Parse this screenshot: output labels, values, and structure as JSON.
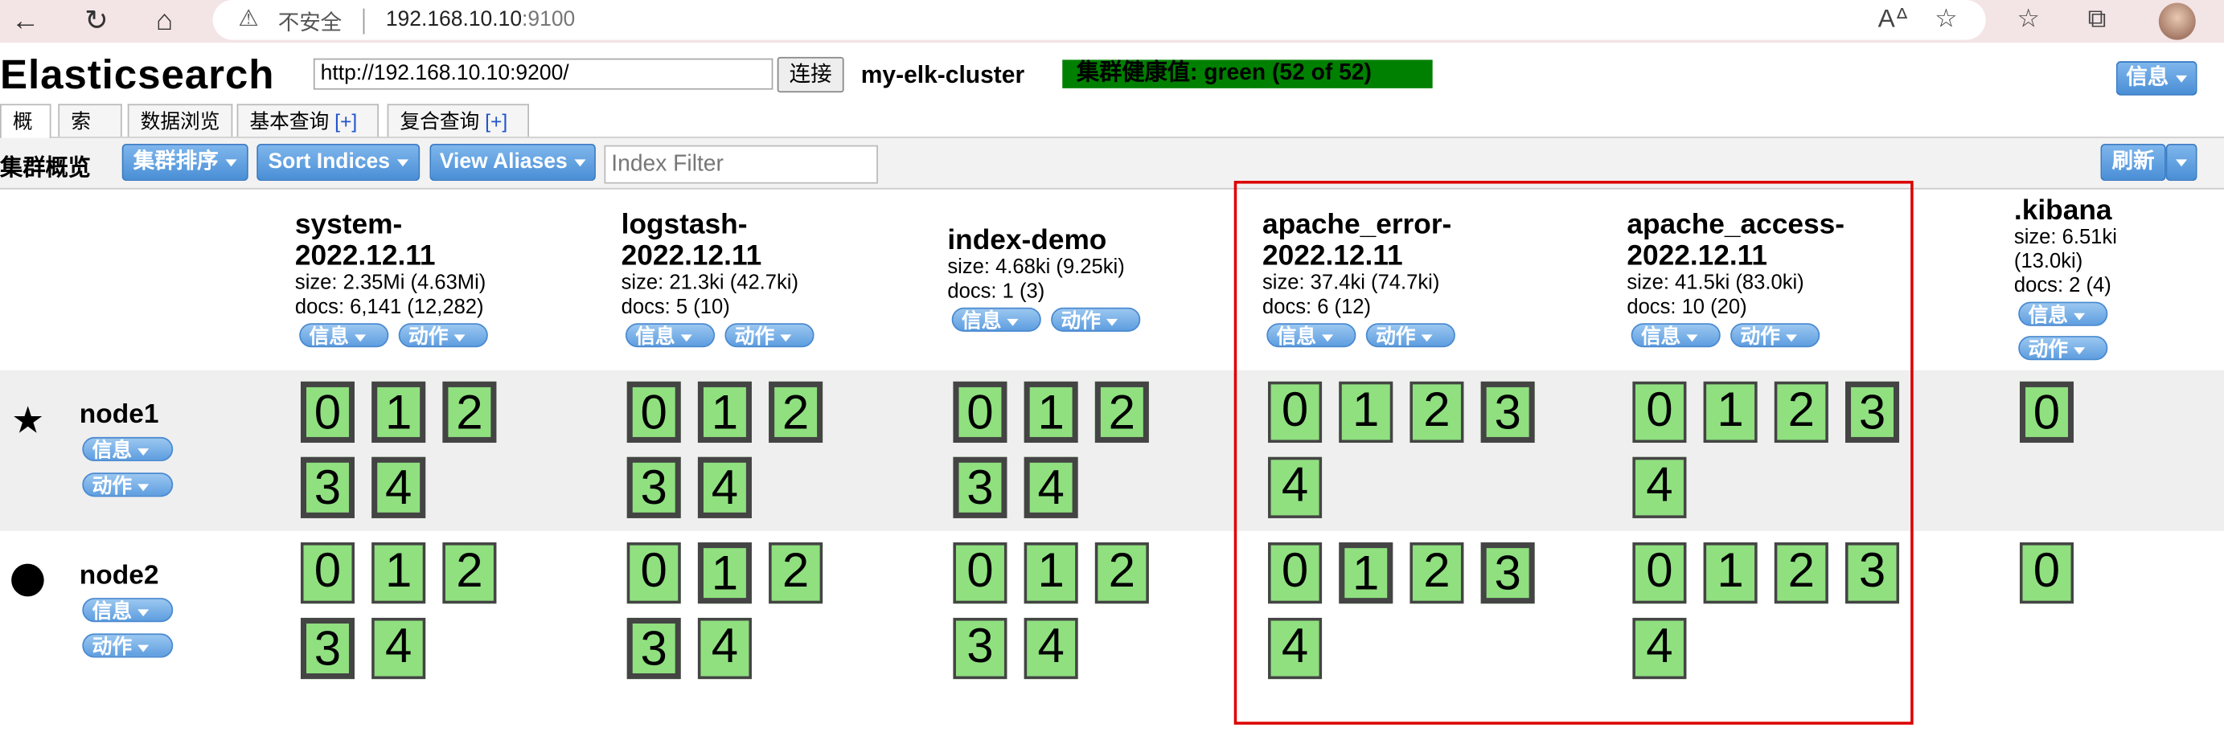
{
  "browser": {
    "security_label": "不安全",
    "url_host": "192.168.10.10",
    "url_port": ":9100"
  },
  "header": {
    "brand": "Elasticsearch",
    "connection_url": "http://192.168.10.10:9200/",
    "connect_label": "连接",
    "cluster_name": "my-elk-cluster",
    "health": "集群健康值: green (52 of 52)",
    "health_color": "#008000",
    "info_label": "信息"
  },
  "tabs": [
    {
      "label": "概览"
    },
    {
      "label": "索引"
    },
    {
      "label": "数据浏览"
    },
    {
      "label": "基本查询",
      "plus": "[+]"
    },
    {
      "label": "复合查询",
      "plus": "[+]"
    }
  ],
  "toolbar": {
    "title": "集群概览",
    "sort_cluster": "集群排序",
    "sort_indices": "Sort Indices",
    "view_aliases": "View Aliases",
    "filter_placeholder": "Index Filter",
    "refresh": "刷新"
  },
  "pill": {
    "info": "信息",
    "action": "动作"
  },
  "indices": [
    {
      "name1": "system-",
      "name2": "2022.12.11",
      "size": "size: 2.35Mi (4.63Mi)",
      "docs": "docs: 6,141 (12,282)"
    },
    {
      "name1": "logstash-",
      "name2": "2022.12.11",
      "size": "size: 21.3ki (42.7ki)",
      "docs": "docs: 5 (10)"
    },
    {
      "name1": "index-demo",
      "size": "size: 4.68ki (9.25ki)",
      "docs": "docs: 1 (3)"
    },
    {
      "name1": "apache_error-",
      "name2": "2022.12.11",
      "size": "size: 37.4ki (74.7ki)",
      "docs": "docs: 6 (12)"
    },
    {
      "name1": "apache_access-",
      "name2": "2022.12.11",
      "size": "size: 41.5ki (83.0ki)",
      "docs": "docs: 10 (20)"
    },
    {
      "name1": ".kibana",
      "size": "size: 6.51ki",
      "size2": "(13.0ki)",
      "docs": "docs: 2 (4)"
    }
  ],
  "nodes": [
    {
      "name": "node1",
      "icon": "star-icon"
    },
    {
      "name": "node2",
      "icon": "circle-icon"
    }
  ],
  "shards": {
    "s0": "0",
    "s1": "1",
    "s2": "2",
    "s3": "3",
    "s4": "4"
  }
}
